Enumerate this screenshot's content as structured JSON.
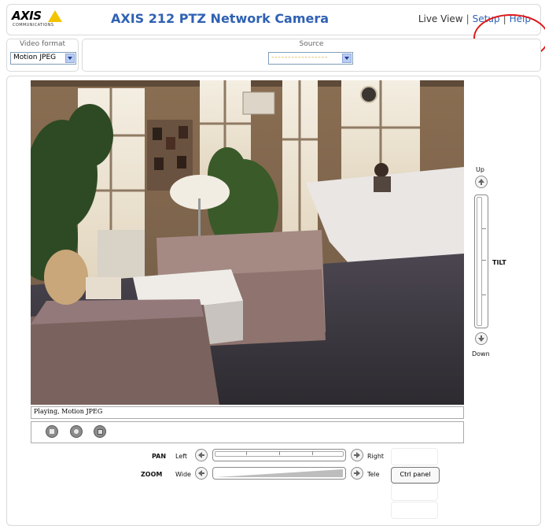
{
  "header": {
    "logo_text": "AXIS",
    "logo_sub": "COMMUNICATIONS",
    "title": "AXIS 212 PTZ Network Camera",
    "nav": {
      "live_view": "Live View",
      "sep": "|",
      "setup": "Setup",
      "help": "Help"
    }
  },
  "format_bar": {
    "video_format_label": "Video format",
    "video_format_value": "Motion JPEG",
    "source_label": "Source",
    "source_value": "-----------------"
  },
  "video": {
    "status": "Playing, Motion JPEG"
  },
  "controls": {
    "stop_icon": "stop-icon",
    "snapshot_icon": "camera-icon",
    "fullscreen_icon": "fullscreen-icon"
  },
  "tilt": {
    "up": "Up",
    "down": "Down",
    "label": "TILT"
  },
  "pan": {
    "label": "PAN",
    "left": "Left",
    "right": "Right"
  },
  "zoom": {
    "label": "ZOOM",
    "wide": "Wide",
    "tele": "Tele"
  },
  "ctrl_panel": "Ctrl panel",
  "colors": {
    "title_blue": "#2f61b3",
    "highlight_red": "#e01818",
    "logo_yellow": "#f3c300"
  }
}
